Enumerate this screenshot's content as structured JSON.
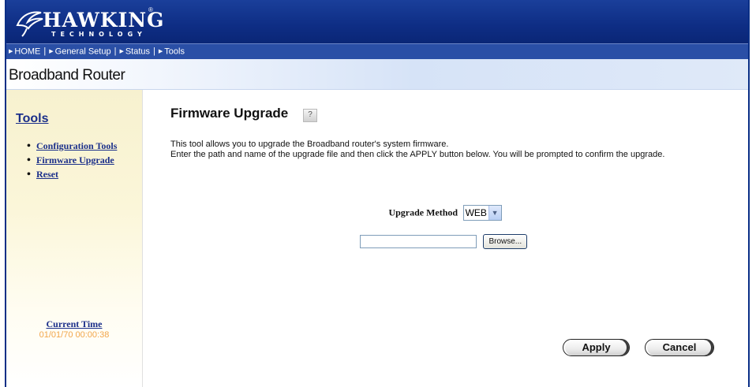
{
  "brand": {
    "name": "HAWKING",
    "sub": "TECHNOLOGY",
    "reg": "®"
  },
  "nav": [
    {
      "label": "HOME"
    },
    {
      "label": "General Setup"
    },
    {
      "label": "Status"
    },
    {
      "label": "Tools"
    }
  ],
  "banner": {
    "title": "Broadband Router"
  },
  "sidebar": {
    "title": "Tools",
    "items": [
      {
        "label": "Configuration Tools"
      },
      {
        "label": "Firmware Upgrade"
      },
      {
        "label": "Reset"
      }
    ],
    "time_label": "Current Time",
    "time_value": "01/01/70 00:00:38"
  },
  "main": {
    "title": "Firmware Upgrade",
    "help_icon": "help-icon",
    "description_line1": "This tool allows you to upgrade the Broadband router's system firmware.",
    "description_line2": "Enter the path and name of the upgrade file and then click the APPLY button below. You will be prompted to confirm the upgrade.",
    "method_label": "Upgrade Method",
    "method_value": "WEB",
    "file_value": "",
    "browse_label": "Browse...",
    "apply_label": "Apply",
    "cancel_label": "Cancel"
  },
  "colors": {
    "header": "#0e2d84",
    "nav": "#2a4fa6",
    "link": "#1b2f8a",
    "time": "#f2a64a"
  }
}
